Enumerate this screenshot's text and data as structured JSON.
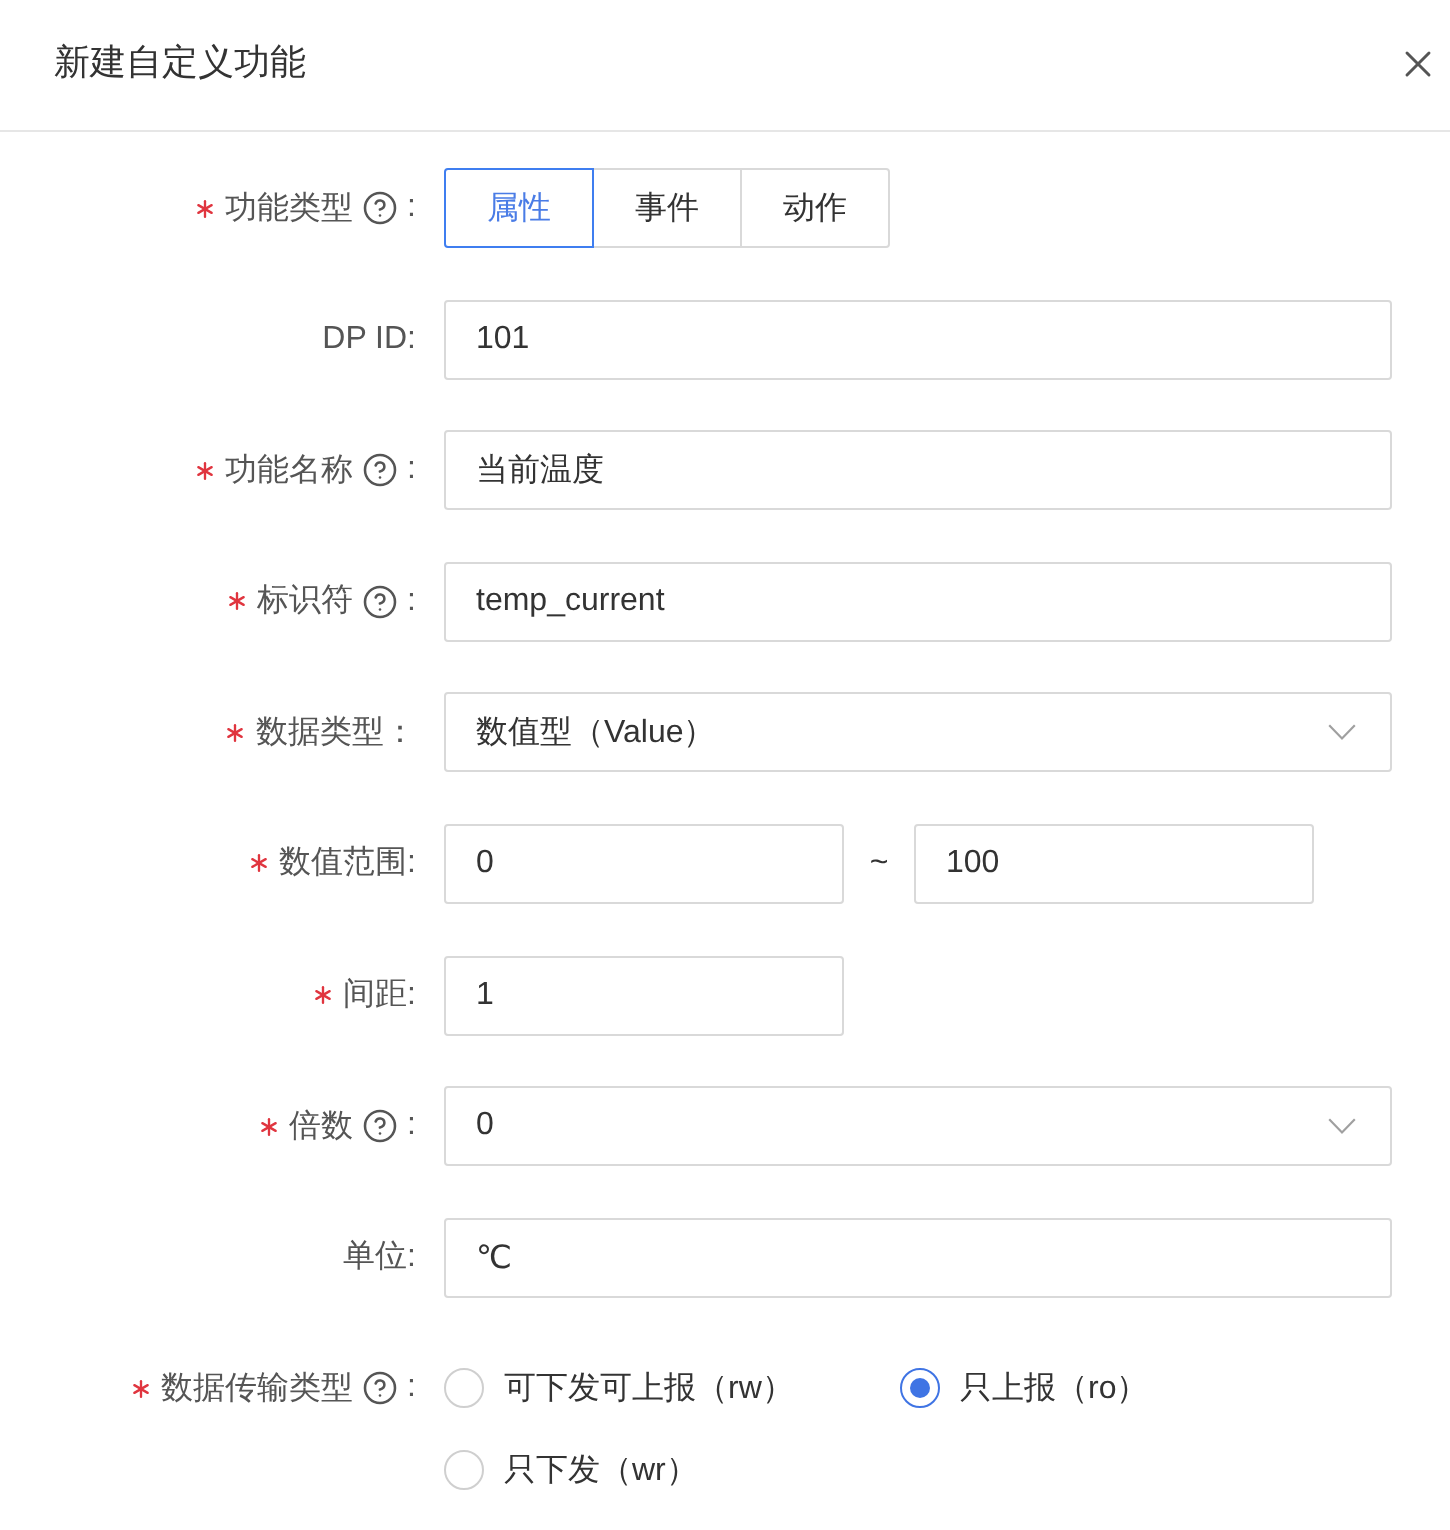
{
  "dialog": {
    "title": "新建自定义功能"
  },
  "form": {
    "fields": [
      {
        "kind": "segmented",
        "label": "功能类型",
        "colon": ":",
        "required": true,
        "help": true,
        "options": [
          {
            "label": "属性",
            "selected": true
          },
          {
            "label": "事件",
            "selected": false
          },
          {
            "label": "动作",
            "selected": false
          }
        ]
      },
      {
        "kind": "input",
        "label": "DP ID",
        "colon": ":",
        "required": false,
        "help": false,
        "value": "101"
      },
      {
        "kind": "input",
        "label": "功能名称",
        "colon": ":",
        "required": true,
        "help": true,
        "value": "当前温度"
      },
      {
        "kind": "input",
        "label": "标识符",
        "colon": ":",
        "required": true,
        "help": true,
        "value": "temp_current"
      },
      {
        "kind": "select",
        "label": "数据类型",
        "colon": "：",
        "required": true,
        "help": false,
        "value": "数值型（Value）"
      },
      {
        "kind": "range",
        "label": "数值范围",
        "colon": ":",
        "required": true,
        "help": false,
        "min": "0",
        "separator": "~",
        "max": "100"
      },
      {
        "kind": "compact",
        "label": "间距",
        "colon": ":",
        "required": true,
        "help": false,
        "value": "1"
      },
      {
        "kind": "select",
        "label": "倍数",
        "colon": ":",
        "required": true,
        "help": true,
        "value": "0"
      },
      {
        "kind": "input",
        "label": "单位",
        "colon": ":",
        "required": false,
        "help": false,
        "value": "℃"
      },
      {
        "kind": "radio",
        "label": "数据传输类型",
        "colon": ":",
        "required": true,
        "help": true,
        "options": [
          {
            "label": "可下发可上报（rw）",
            "selected": false
          },
          {
            "label": "只上报（ro）",
            "selected": true
          },
          {
            "label": "只下发（wr）",
            "selected": false
          }
        ]
      }
    ]
  }
}
